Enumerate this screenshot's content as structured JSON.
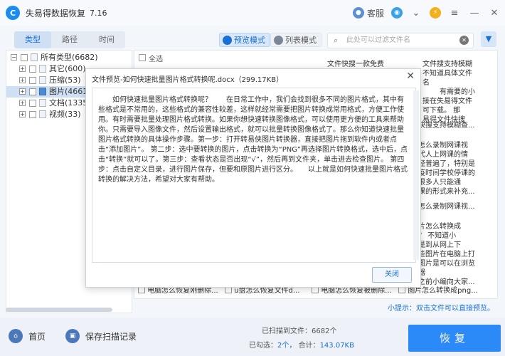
{
  "app": {
    "title": "失易得数据恢复",
    "version": "7.16",
    "service_label": "客服",
    "logo_glyph": "C"
  },
  "side_tabs": [
    "类型",
    "路径",
    "时间"
  ],
  "view_modes": {
    "preview_label": "预览模式",
    "list_label": "列表模式"
  },
  "search": {
    "placeholder": "此处可以过滤文件名"
  },
  "tree": [
    {
      "label": "所有类型(6682)",
      "pm": "−"
    },
    {
      "label": "其它(600)",
      "pm": "+"
    },
    {
      "label": "压缩(53)",
      "pm": "+"
    },
    {
      "label": "图片(4661)",
      "pm": "+"
    },
    {
      "label": "文档(1335)",
      "pm": "+"
    },
    {
      "label": "视频(33)",
      "pm": "+"
    }
  ],
  "select_all_label": "全选",
  "background_snippets": [
    "文件快搜一款免费",
    "文件搜支持模糊",
    "不知道具体文件名",
    "有需要的小",
    "接在失易得文件",
    "可下载。 那",
    "易得文件快搜",
    "快搜支持模糊查...",
    "怎么录制网课视",
    "代人上网课的情",
    "经普遍了，特别是",
    "疫时间学校停课的",
    "很多人只能通",
    "课的形式来补充...",
    "怎么录制网课视...",
    "片怎么转换成",
    "？ 不知道小",
    "是到从网上下",
    "些图片在电脑上打",
    "图片是可以在浏览器",
    "之前小编向大家..."
  ],
  "background_row": [
    "电脑怎么恢复刚删除...",
    "u盘怎么恢复文件d...",
    "电脑怎么恢复被删除...",
    "图片怎么转换成png..."
  ],
  "hint": {
    "prefix": "小提示：",
    "text": "双击文件可以直接预览。"
  },
  "dialog": {
    "title": "文件预览-如何快速批量图片格式转换呢.docx（299.17KB）",
    "body": "　　如何快速批量图片格式转换呢？　　在日常工作中，我们会找到很多不同的图片格式，其中有些格式是不常用的，这些格式的兼容性较差，这样就经常需要把图片转换成常用格式，方便工作使用。有时需要批量处理图片格式转换。如果你想快速转换图像格式，可以使用更方便的工具来帮助你。只需要导入图像文件，然后设置输出格式，就可以批量转换图像格式了。那么你知道快速批量图片格式转换的具体操作步骤。第一步：打开转易侠图片转换器，直接把图片拖到软件内或者点击“添加图片”。 第二步：选中要转换的图片，点击转换为“PNG”再选择图片转换格式，选中后，点击“转换”就可以了。第三步：查看状态是否出现“√”，然后再到文件夹，单击进去检查图片。 第四步：点击自定义目录，进行图片保存，但要和原图片进行区分。　　以上就是如何快速批量图片格式转换的解决方法，希望对大家有帮助。",
    "close_label": "关闭"
  },
  "bottom": {
    "home_label": "首页",
    "save_label": "保存扫描记录",
    "found_prefix": "已扫描到文件：",
    "found_count": "6682个",
    "selected_prefix": "已勾选：",
    "selected_count": "2个，",
    "total_prefix": "合计：",
    "total_size": "143.07KB",
    "recover_label": "恢复"
  },
  "colors": {
    "accent": "#1a8cf0",
    "recover": "#2b8af7",
    "selected_row": "#cfe0f5"
  }
}
